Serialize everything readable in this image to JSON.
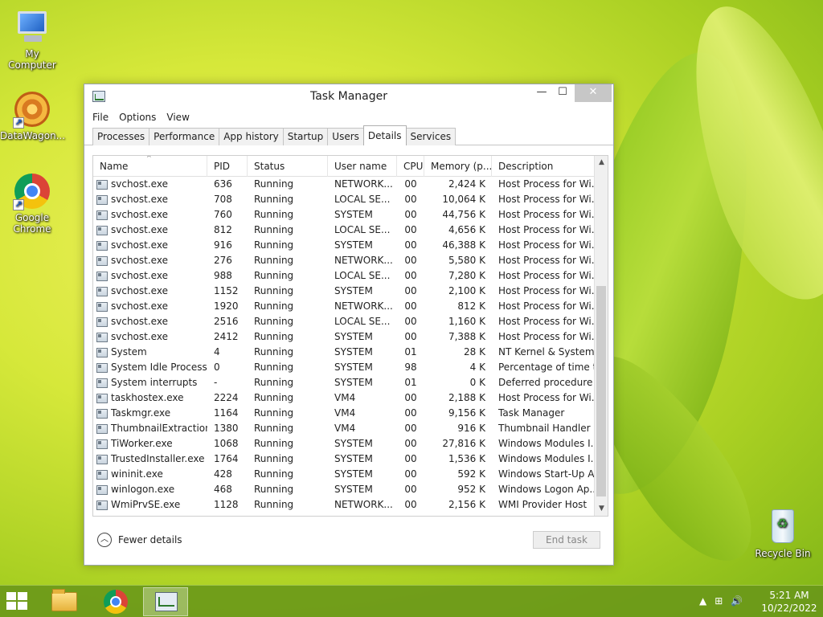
{
  "desktop": {
    "icons": [
      {
        "label": "My Computer"
      },
      {
        "label": "DataWagon..."
      },
      {
        "label": "Google Chrome"
      },
      {
        "label": "Recycle Bin"
      }
    ]
  },
  "window": {
    "title": "Task Manager",
    "controls": {
      "minimize": "—",
      "maximize": "☐",
      "close": "✕"
    },
    "menu": [
      "File",
      "Options",
      "View"
    ],
    "tabs": [
      "Processes",
      "Performance",
      "App history",
      "Startup",
      "Users",
      "Details",
      "Services"
    ],
    "active_tab": "Details",
    "columns": [
      "Name",
      "PID",
      "Status",
      "User name",
      "CPU",
      "Memory (p...",
      "Description"
    ],
    "rows": [
      [
        "svchost.exe",
        "636",
        "Running",
        "NETWORK...",
        "00",
        "2,424 K",
        "Host Process for Wi..."
      ],
      [
        "svchost.exe",
        "708",
        "Running",
        "LOCAL SE...",
        "00",
        "10,064 K",
        "Host Process for Wi..."
      ],
      [
        "svchost.exe",
        "760",
        "Running",
        "SYSTEM",
        "00",
        "44,756 K",
        "Host Process for Wi..."
      ],
      [
        "svchost.exe",
        "812",
        "Running",
        "LOCAL SE...",
        "00",
        "4,656 K",
        "Host Process for Wi..."
      ],
      [
        "svchost.exe",
        "916",
        "Running",
        "SYSTEM",
        "00",
        "46,388 K",
        "Host Process for Wi..."
      ],
      [
        "svchost.exe",
        "276",
        "Running",
        "NETWORK...",
        "00",
        "5,580 K",
        "Host Process for Wi..."
      ],
      [
        "svchost.exe",
        "988",
        "Running",
        "LOCAL SE...",
        "00",
        "7,280 K",
        "Host Process for Wi..."
      ],
      [
        "svchost.exe",
        "1152",
        "Running",
        "SYSTEM",
        "00",
        "2,100 K",
        "Host Process for Wi..."
      ],
      [
        "svchost.exe",
        "1920",
        "Running",
        "NETWORK...",
        "00",
        "812 K",
        "Host Process for Wi..."
      ],
      [
        "svchost.exe",
        "2516",
        "Running",
        "LOCAL SE...",
        "00",
        "1,160 K",
        "Host Process for Wi..."
      ],
      [
        "svchost.exe",
        "2412",
        "Running",
        "SYSTEM",
        "00",
        "7,388 K",
        "Host Process for Wi..."
      ],
      [
        "System",
        "4",
        "Running",
        "SYSTEM",
        "01",
        "28 K",
        "NT Kernel & System"
      ],
      [
        "System Idle Process",
        "0",
        "Running",
        "SYSTEM",
        "98",
        "4 K",
        "Percentage of time t..."
      ],
      [
        "System interrupts",
        "-",
        "Running",
        "SYSTEM",
        "01",
        "0 K",
        "Deferred procedure ..."
      ],
      [
        "taskhostex.exe",
        "2224",
        "Running",
        "VM4",
        "00",
        "2,188 K",
        "Host Process for Wi..."
      ],
      [
        "Taskmgr.exe",
        "1164",
        "Running",
        "VM4",
        "00",
        "9,156 K",
        "Task Manager"
      ],
      [
        "ThumbnailExtraction...",
        "1380",
        "Running",
        "VM4",
        "00",
        "916 K",
        "Thumbnail Handler ..."
      ],
      [
        "TiWorker.exe",
        "1068",
        "Running",
        "SYSTEM",
        "00",
        "27,816 K",
        "Windows Modules I..."
      ],
      [
        "TrustedInstaller.exe",
        "1764",
        "Running",
        "SYSTEM",
        "00",
        "1,536 K",
        "Windows Modules I..."
      ],
      [
        "wininit.exe",
        "428",
        "Running",
        "SYSTEM",
        "00",
        "592 K",
        "Windows Start-Up A..."
      ],
      [
        "winlogon.exe",
        "468",
        "Running",
        "SYSTEM",
        "00",
        "952 K",
        "Windows Logon Ap..."
      ],
      [
        "WmiPrvSE.exe",
        "1128",
        "Running",
        "NETWORK...",
        "00",
        "2,156 K",
        "WMI Provider Host"
      ]
    ],
    "footer": {
      "fewer_details": "Fewer details",
      "end_task": "End task"
    }
  },
  "taskbar": {
    "clock": {
      "time": "5:21 AM",
      "date": "10/22/2022"
    },
    "tray_icons": [
      "▲",
      "⊞",
      "🔊"
    ]
  }
}
